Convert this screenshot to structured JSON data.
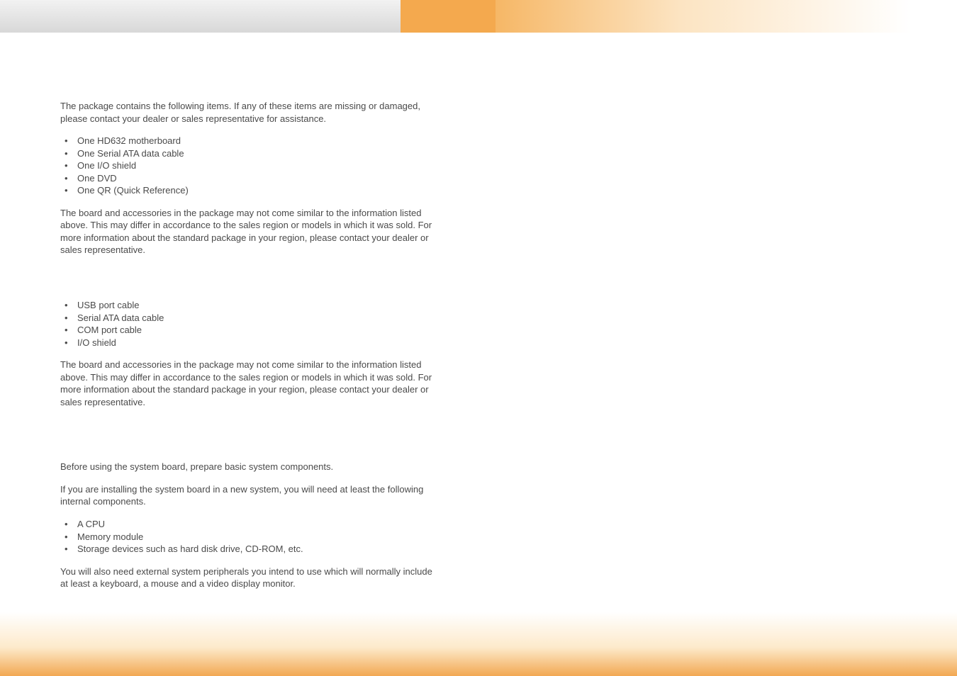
{
  "section1": {
    "intro": "The package contains the following items. If any of these items are missing or damaged, please contact your dealer or sales representative for assistance.",
    "items": [
      "One HD632 motherboard",
      "One Serial ATA data cable",
      "One I/O shield",
      "One DVD",
      "One QR (Quick Reference)"
    ],
    "note": "The board and accessories in the package may not come similar to the information listed above. This may differ in accordance to the sales region or models in which it was sold. For more information about the standard package in your region, please contact your dealer or sales representative."
  },
  "section2": {
    "items": [
      "USB port cable",
      "Serial ATA data cable",
      "COM port cable",
      "I/O shield"
    ],
    "note": "The board and accessories in the package may not come similar to the information listed above. This may differ in accordance to the sales region or models in which it was sold. For more information about the standard package in your region, please contact your dealer or sales representative."
  },
  "section3": {
    "intro1": "Before using the system board, prepare basic system components.",
    "intro2": "If you are installing the system board in a new system, you will need at least the following internal components.",
    "items": [
      "A CPU",
      "Memory module",
      "Storage devices such as hard disk drive, CD-ROM, etc."
    ],
    "outro": "You will also need external system peripherals you intend to use which will normally include at least a keyboard, a mouse and a video display monitor."
  }
}
